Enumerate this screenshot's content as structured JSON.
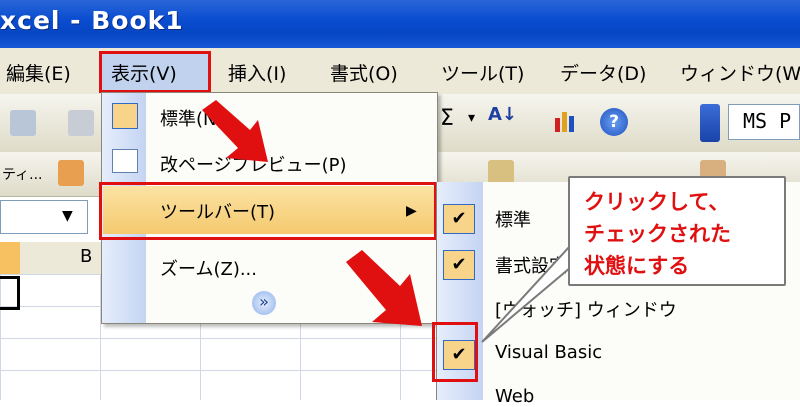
{
  "window": {
    "title": "xcel - Book1"
  },
  "menubar": {
    "items": [
      {
        "label": "編集(E)"
      },
      {
        "label": "表示(V)"
      },
      {
        "label": "挿入(I)"
      },
      {
        "label": "書式(O)"
      },
      {
        "label": "ツール(T)"
      },
      {
        "label": "データ(D)"
      },
      {
        "label": "ウィンドウ(W)"
      }
    ]
  },
  "toolbar": {
    "font_name": "MS P",
    "row2_label": "ティ..."
  },
  "sheet": {
    "column_b": "B"
  },
  "view_menu": {
    "items": [
      {
        "label": "標準(N)"
      },
      {
        "label": "改ページプレビュー(P)"
      },
      {
        "label": "ツールバー(T)"
      },
      {
        "label": "ズーム(Z)..."
      }
    ],
    "expand_symbol": "»"
  },
  "toolbar_submenu": {
    "items": [
      {
        "label": "標準",
        "checked": true
      },
      {
        "label": "書式設定",
        "checked": true
      },
      {
        "label": "[ウォッチ] ウィンドウ",
        "checked": false
      },
      {
        "label": "Visual Basic",
        "checked": true
      },
      {
        "label": "Web",
        "checked": false
      }
    ]
  },
  "callout": {
    "lines": [
      "クリックして、",
      "チェックされた",
      "状態にする"
    ]
  },
  "colors": {
    "highlight_red": "#e01010",
    "title_blue": "#0a4dd0",
    "menu_hover": "#f5c96e"
  }
}
